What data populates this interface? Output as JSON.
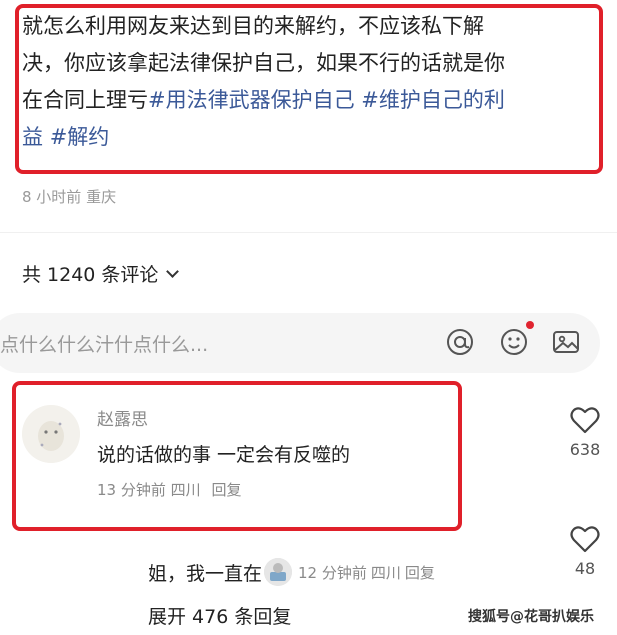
{
  "post": {
    "line1": "就怎么利用网友来达到目的来解约，不应该私下解",
    "line2": "决，你应该拿起法律保护自己，如果不行的话就是你",
    "line3_text": "在合同上理亏",
    "line3_tag1": "#用法律武器保护自己",
    "line3_tag2": "#维护自己的利",
    "line4_tag": "益",
    "line4_tag2": "#解约",
    "meta": "8 小时前 重庆"
  },
  "comments_header": {
    "count_label": "共 1240 条评论"
  },
  "comment_input": {
    "placeholder": "点什么什么汁什点什么..."
  },
  "comment": {
    "author": "赵露思",
    "text": "说的话做的事 一定会有反噬的",
    "time": "13 分钟前",
    "location": "四川",
    "reply_label": "回复",
    "likes": "638"
  },
  "reply": {
    "text": "姐，我一直在",
    "time": "12 分钟前",
    "location": "四川",
    "reply_label": "回复",
    "likes": "48"
  },
  "expand": {
    "label": "展开 476 条回复"
  },
  "watermark": {
    "text": "搜狐号@花哥扒娱乐"
  },
  "colors": {
    "highlight_border": "#e0202a",
    "hashtag": "#3b5998",
    "notification_dot": "#e02430"
  },
  "icons": [
    "at-icon",
    "emoji-icon",
    "image-icon",
    "heart-icon",
    "chevron-down-icon"
  ]
}
